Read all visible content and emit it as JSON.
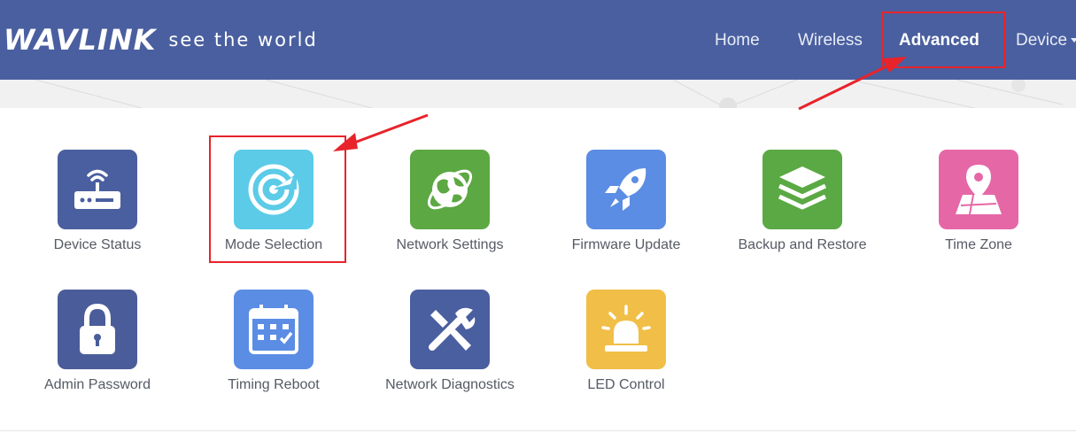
{
  "header": {
    "logo_text": "WAVLINK",
    "tagline": "see the world",
    "nav": [
      {
        "label": "Home",
        "active": false
      },
      {
        "label": "Wireless",
        "active": false
      },
      {
        "label": "Advanced",
        "active": true
      },
      {
        "label": "Device",
        "active": false
      }
    ]
  },
  "tiles": [
    {
      "label": "Device Status",
      "icon": "router-icon",
      "color": "#4a5f9f"
    },
    {
      "label": "Mode Selection",
      "icon": "radar-icon",
      "color": "#5bcbe7"
    },
    {
      "label": "Network Settings",
      "icon": "globe-icon",
      "color": "#5ca843"
    },
    {
      "label": "Firmware Update",
      "icon": "rocket-icon",
      "color": "#5b8de4"
    },
    {
      "label": "Backup and Restore",
      "icon": "layers-icon",
      "color": "#5aa944"
    },
    {
      "label": "Time Zone",
      "icon": "map-pin-icon",
      "color": "#e567a6"
    },
    {
      "label": "Admin Password",
      "icon": "lock-icon",
      "color": "#4a5d9a"
    },
    {
      "label": "Timing Reboot",
      "icon": "calendar-icon",
      "color": "#5b8de4"
    },
    {
      "label": "Network Diagnostics",
      "icon": "tools-icon",
      "color": "#4a5f9f"
    },
    {
      "label": "LED Control",
      "icon": "alarm-light-icon",
      "color": "#f1be47"
    }
  ],
  "annotations": {
    "color": "#e8232a"
  }
}
